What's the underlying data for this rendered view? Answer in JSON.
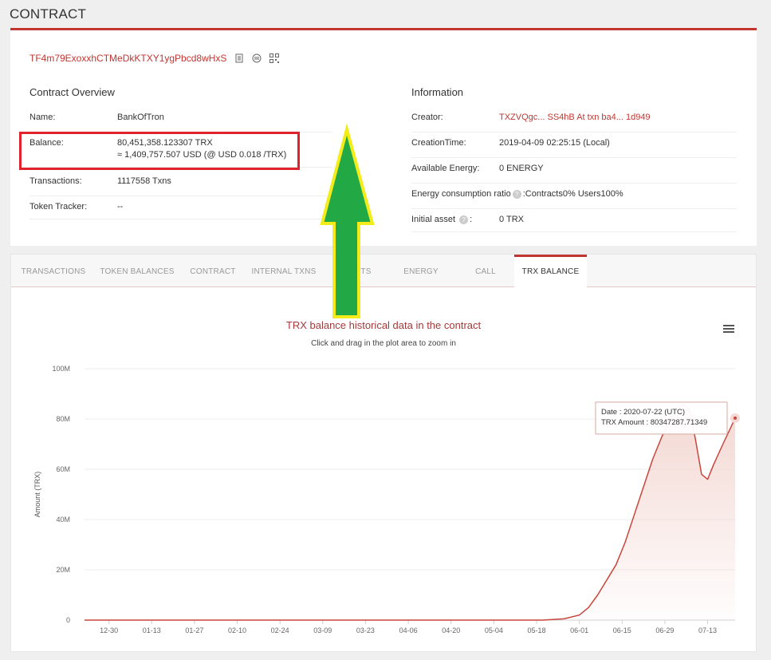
{
  "page": {
    "title": "CONTRACT"
  },
  "contract": {
    "address": "TF4m79ExoxxhCTMeDkKTXY1ygPbcd8wHxS"
  },
  "overview": {
    "heading": "Contract Overview",
    "rows": [
      {
        "label": "Name:",
        "value": "BankOfTron"
      },
      {
        "label": "Balance:",
        "value": "80,451,358.123307 TRX",
        "value2": "≈ 1,409,757.507 USD (@ USD 0.018 /TRX)"
      },
      {
        "label": "Transactions:",
        "value": "1117558  Txns"
      },
      {
        "label": "Token Tracker:",
        "value": "--"
      }
    ]
  },
  "information": {
    "heading": "Information",
    "creator_label": "Creator:",
    "creator_value": "TXZVQgc... SS4hB At txn ba4... 1d949",
    "creation_label": "CreationTime:",
    "creation_value": "2019-04-09 02:25:15 (Local)",
    "energy_label": "Available Energy:",
    "energy_value": "0  ENERGY",
    "ratio_label": "Energy consumption ratio",
    "ratio_value": ":Contracts0%  Users100%",
    "initial_label": "Initial asset",
    "initial_value": "0 TRX",
    "help_glyph": "?"
  },
  "tabs": [
    {
      "label": "TRANSACTIONS",
      "active": false
    },
    {
      "label": "TOKEN BALANCES",
      "active": false
    },
    {
      "label": "CONTRACT",
      "active": false
    },
    {
      "label": "INTERNAL TXNS",
      "active": false
    },
    {
      "label": "EVENTS",
      "active": false
    },
    {
      "label": "ENERGY",
      "active": false
    },
    {
      "label": "CALL",
      "active": false
    },
    {
      "label": "TRX BALANCE",
      "active": true
    }
  ],
  "chart_data": {
    "type": "area",
    "title": "TRX balance historical data in the contract",
    "subtitle": "Click and drag in the plot area to zoom in",
    "ylabel": "Amount  (TRX)",
    "ylim": [
      0,
      100000000
    ],
    "y_ticks": [
      "0",
      "20M",
      "40M",
      "60M",
      "80M",
      "100M"
    ],
    "x_ticks": [
      "12-30",
      "01-13",
      "01-27",
      "02-10",
      "02-24",
      "03-09",
      "03-23",
      "04-06",
      "04-20",
      "05-04",
      "05-18",
      "06-01",
      "06-15",
      "06-29",
      "07-13"
    ],
    "series": [
      {
        "points": [
          [
            "2019-12-22",
            0
          ],
          [
            "2020-05-20",
            0
          ],
          [
            "2020-05-27",
            500000
          ],
          [
            "2020-06-01",
            2000000
          ],
          [
            "2020-06-04",
            5000000
          ],
          [
            "2020-06-07",
            10000000
          ],
          [
            "2020-06-10",
            16000000
          ],
          [
            "2020-06-13",
            22000000
          ],
          [
            "2020-06-16",
            31000000
          ],
          [
            "2020-06-19",
            42000000
          ],
          [
            "2020-06-22",
            53000000
          ],
          [
            "2020-06-25",
            64000000
          ],
          [
            "2020-06-28",
            73000000
          ],
          [
            "2020-07-01",
            80000000
          ],
          [
            "2020-07-03",
            84000000
          ],
          [
            "2020-07-05",
            86000000
          ],
          [
            "2020-07-07",
            84000000
          ],
          [
            "2020-07-09",
            72000000
          ],
          [
            "2020-07-11",
            58000000
          ],
          [
            "2020-07-13",
            56000000
          ],
          [
            "2020-07-15",
            62000000
          ],
          [
            "2020-07-18",
            70000000
          ],
          [
            "2020-07-22",
            80347287.71349
          ]
        ]
      }
    ],
    "colors": {
      "line": "#c8463c",
      "fill": "#f3d7d2"
    },
    "tooltip": {
      "date_line": "Date : 2020-07-22 (UTC)",
      "amount_line": "TRX Amount : 80347287.71349"
    }
  },
  "annotations": {
    "highlight_color": "#e0242e",
    "arrow_fill": "#22a845",
    "arrow_stroke": "#f3ec1a"
  }
}
